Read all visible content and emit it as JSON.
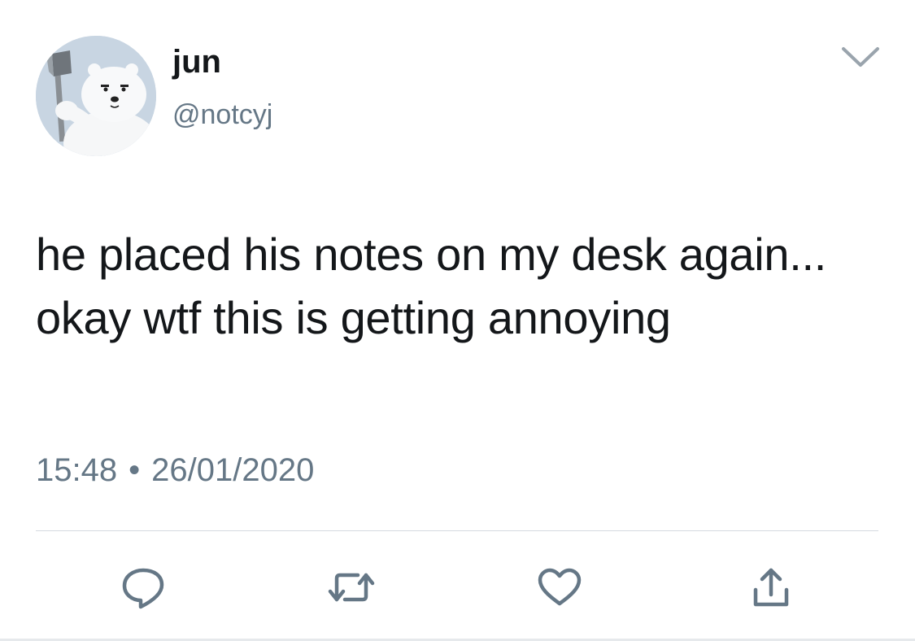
{
  "tweet": {
    "author": {
      "display_name": "jun",
      "handle": "@notcyj",
      "avatar_icon": "polar-bear-with-axe-avatar"
    },
    "text": "he placed his notes on my desk again... okay wtf this is getting annoying",
    "time": "15:48",
    "separator": "•",
    "date": "26/01/2020"
  },
  "actions": [
    {
      "name": "reply",
      "icon": "reply-icon"
    },
    {
      "name": "retweet",
      "icon": "retweet-icon"
    },
    {
      "name": "like",
      "icon": "heart-icon"
    },
    {
      "name": "share",
      "icon": "share-icon"
    }
  ],
  "colors": {
    "text": "#14171a",
    "secondary": "#657786",
    "icon": "#657786",
    "divider": "#d5dadf"
  }
}
